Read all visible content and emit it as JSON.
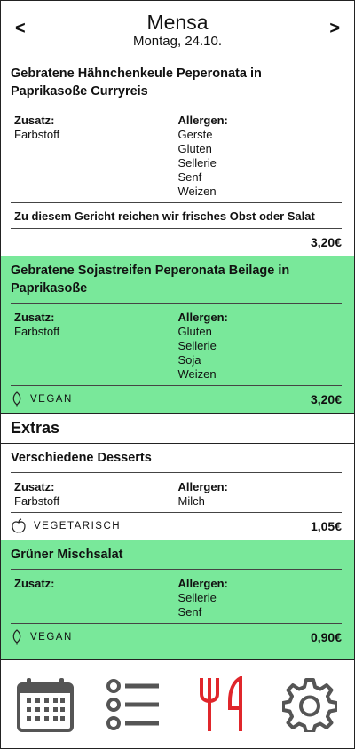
{
  "header": {
    "prev": "<",
    "next": ">",
    "title": "Mensa",
    "date": "Montag, 24.10."
  },
  "meals": [
    {
      "title": "Gebratene Hähnchenkeule Peperonata in Paprikasoße Curryreis",
      "zusatz_label": "Zusatz:",
      "zusatz": [
        "Farbstoff"
      ],
      "allergen_label": "Allergen:",
      "allergens": [
        "Gerste",
        "Gluten",
        "Sellerie",
        "Senf",
        "Weizen"
      ],
      "note": "Zu diesem Gericht reichen wir frisches Obst oder Salat",
      "diet": "",
      "price": "3,20€"
    },
    {
      "title": "Gebratene Sojastreifen Peperonata Beilage in Paprikasoße",
      "zusatz_label": "Zusatz:",
      "zusatz": [
        "Farbstoff"
      ],
      "allergen_label": "Allergen:",
      "allergens": [
        "Gluten",
        "Sellerie",
        "Soja",
        "Weizen"
      ],
      "diet": "VEGAN",
      "price": "3,20€"
    }
  ],
  "extras_heading": "Extras",
  "extras": [
    {
      "title": "Verschiedene Desserts",
      "zusatz_label": "Zusatz:",
      "zusatz": [
        "Farbstoff"
      ],
      "allergen_label": "Allergen:",
      "allergens": [
        "Milch"
      ],
      "diet": "VEGETARISCH",
      "price": "1,05€"
    },
    {
      "title": "Grüner Mischsalat",
      "zusatz_label": "Zusatz:",
      "zusatz": [],
      "allergen_label": "Allergen:",
      "allergens": [
        "Sellerie",
        "Senf"
      ],
      "diet": "VEGAN",
      "price": "0,90€"
    }
  ],
  "colors": {
    "highlight": "#79e89a",
    "active_tab": "#e0262b",
    "inactive_tab": "#555555"
  },
  "bottom_nav": [
    "calendar-icon",
    "list-icon",
    "cutlery-icon",
    "gear-icon"
  ]
}
